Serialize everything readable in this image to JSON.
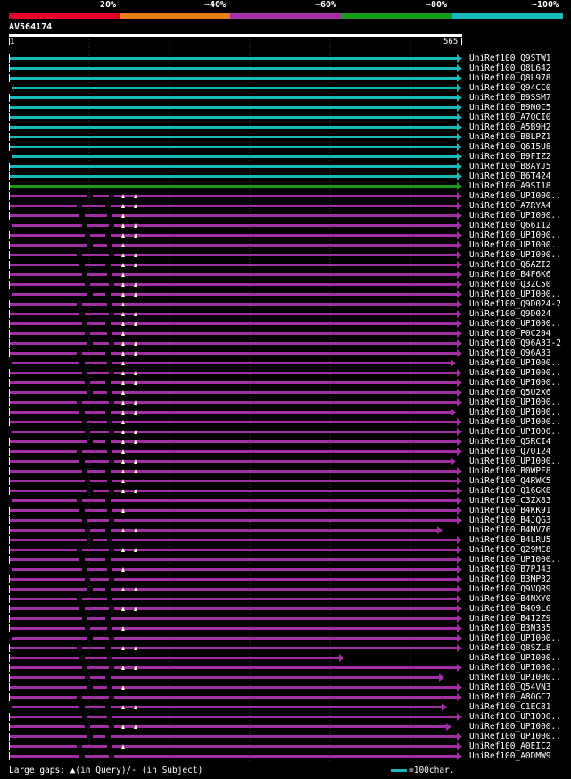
{
  "legend": {
    "labels": [
      "20%",
      "~40%",
      "~60%",
      "~80%",
      "~100%"
    ],
    "colors": [
      "#e4002b",
      "#e67e14",
      "#a32ea3",
      "#1a9a1a",
      "#17b8b8"
    ]
  },
  "query": {
    "id": "AV564174",
    "start": "1",
    "end": "565"
  },
  "hits": [
    {
      "label": "UniRef100_Q9STW1",
      "color": "#17b8b8"
    },
    {
      "label": "UniRef100_Q8L642",
      "color": "#17b8b8"
    },
    {
      "label": "UniRef100_Q8L978",
      "color": "#17b8b8"
    },
    {
      "label": "UniRef100_Q94CC0",
      "color": "#17b8b8"
    },
    {
      "label": "UniRef100_B9SSM7",
      "color": "#17b8b8"
    },
    {
      "label": "UniRef100_B9N0C5",
      "color": "#17b8b8"
    },
    {
      "label": "UniRef100_A7QCI0",
      "color": "#17b8b8"
    },
    {
      "label": "UniRef100_A5B9H2",
      "color": "#17b8b8"
    },
    {
      "label": "UniRef100_B8LPZ1",
      "color": "#17b8b8"
    },
    {
      "label": "UniRef100_Q6I5U8",
      "color": "#17b8b8"
    },
    {
      "label": "UniRef100_B9FIZ2",
      "color": "#17b8b8"
    },
    {
      "label": "UniRef100_B8AYJ5",
      "color": "#17b8b8"
    },
    {
      "label": "UniRef100_B6T424",
      "color": "#17b8b8"
    },
    {
      "label": "UniRef100_A9SI18",
      "color": "#1a9a1a"
    },
    {
      "label": "UniRef100_UPI000..",
      "color": "#a32ea3"
    },
    {
      "label": "UniRef100_A7RYA4",
      "color": "#a32ea3"
    },
    {
      "label": "UniRef100_UPI000..",
      "color": "#a32ea3"
    },
    {
      "label": "UniRef100_Q66I12",
      "color": "#a32ea3"
    },
    {
      "label": "UniRef100_UPI000..",
      "color": "#a32ea3"
    },
    {
      "label": "UniRef100_UPI000..",
      "color": "#a32ea3"
    },
    {
      "label": "UniRef100_UPI000..",
      "color": "#a32ea3"
    },
    {
      "label": "UniRef100_Q6AZI2",
      "color": "#a32ea3"
    },
    {
      "label": "UniRef100_B4F6K6",
      "color": "#a32ea3"
    },
    {
      "label": "UniRef100_Q3ZC50",
      "color": "#a32ea3"
    },
    {
      "label": "UniRef100_UPI000..",
      "color": "#a32ea3"
    },
    {
      "label": "UniRef100_Q9D024-2",
      "color": "#a32ea3"
    },
    {
      "label": "UniRef100_Q9D024",
      "color": "#a32ea3"
    },
    {
      "label": "UniRef100_UPI000..",
      "color": "#a32ea3"
    },
    {
      "label": "UniRef100_P0C204",
      "color": "#a32ea3"
    },
    {
      "label": "UniRef100_Q96A33-2",
      "color": "#a32ea3"
    },
    {
      "label": "UniRef100_Q96A33",
      "color": "#a32ea3"
    },
    {
      "label": "UniRef100_UPI000..",
      "color": "#a32ea3"
    },
    {
      "label": "UniRef100_UPI000..",
      "color": "#a32ea3"
    },
    {
      "label": "UniRef100_UPI000..",
      "color": "#a32ea3"
    },
    {
      "label": "UniRef100_Q5U2X6",
      "color": "#a32ea3"
    },
    {
      "label": "UniRef100_UPI000..",
      "color": "#a32ea3"
    },
    {
      "label": "UniRef100_UPI000..",
      "color": "#a32ea3"
    },
    {
      "label": "UniRef100_UPI000..",
      "color": "#a32ea3"
    },
    {
      "label": "UniRef100_UPI000..",
      "color": "#a32ea3"
    },
    {
      "label": "UniRef100_Q5RCI4",
      "color": "#a32ea3"
    },
    {
      "label": "UniRef100_Q7Q124",
      "color": "#a32ea3"
    },
    {
      "label": "UniRef100_UPI000..",
      "color": "#a32ea3"
    },
    {
      "label": "UniRef100_B0WPF8",
      "color": "#a32ea3"
    },
    {
      "label": "UniRef100_Q4RWK5",
      "color": "#a32ea3"
    },
    {
      "label": "UniRef100_Q16GK8",
      "color": "#a32ea3"
    },
    {
      "label": "UniRef100_C3ZX83",
      "color": "#a32ea3"
    },
    {
      "label": "UniRef100_B4KK91",
      "color": "#a32ea3"
    },
    {
      "label": "UniRef100_B4JQG3",
      "color": "#a32ea3"
    },
    {
      "label": "UniRef100_B4MV76",
      "color": "#a32ea3"
    },
    {
      "label": "UniRef100_B4LRU5",
      "color": "#a32ea3"
    },
    {
      "label": "UniRef100_Q29MC8",
      "color": "#a32ea3"
    },
    {
      "label": "UniRef100_UPI000..",
      "color": "#a32ea3"
    },
    {
      "label": "UniRef100_B7PJ43",
      "color": "#a32ea3"
    },
    {
      "label": "UniRef100_B3MP32",
      "color": "#a32ea3"
    },
    {
      "label": "UniRef100_Q9VQR9",
      "color": "#a32ea3"
    },
    {
      "label": "UniRef100_B4NXY0",
      "color": "#a32ea3"
    },
    {
      "label": "UniRef100_B4Q9L6",
      "color": "#a32ea3"
    },
    {
      "label": "UniRef100_B4I2Z9",
      "color": "#a32ea3"
    },
    {
      "label": "UniRef100_B3N335",
      "color": "#a32ea3"
    },
    {
      "label": "UniRef100_UPI000..",
      "color": "#a32ea3"
    },
    {
      "label": "UniRef100_Q8SZL8",
      "color": "#a32ea3"
    },
    {
      "label": "UniRef100_UPI000..",
      "color": "#a32ea3"
    },
    {
      "label": "UniRef100_UPI000..",
      "color": "#a32ea3"
    },
    {
      "label": "UniRef100_UPI000..",
      "color": "#a32ea3"
    },
    {
      "label": "UniRef100_Q54VN3",
      "color": "#a32ea3"
    },
    {
      "label": "UniRef100_A8QGC7",
      "color": "#a32ea3"
    },
    {
      "label": "UniRef100_C1EC81",
      "color": "#a32ea3"
    },
    {
      "label": "UniRef100_UPI000..",
      "color": "#a32ea3"
    },
    {
      "label": "UniRef100_UPI000..",
      "color": "#a32ea3"
    },
    {
      "label": "UniRef100_UPI000..",
      "color": "#a32ea3"
    },
    {
      "label": "UniRef100_A0EIC2",
      "color": "#a32ea3"
    },
    {
      "label": "UniRef100_A0DMW9",
      "color": "#a32ea3"
    }
  ],
  "footer": {
    "text": "Large gaps: ▲(in Query)/- (in Subject)",
    "scale_text": "=100char.",
    "scale_color": "#17b8b8"
  }
}
